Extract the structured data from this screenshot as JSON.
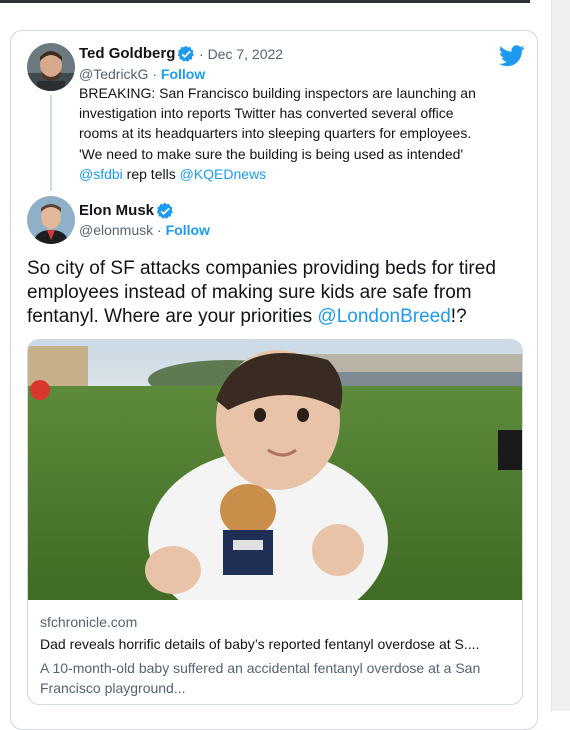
{
  "quoted_tweet": {
    "author_name": "Ted Goldberg",
    "handle": "@TedrickG",
    "date": "Dec 7, 2022",
    "separator": "·",
    "follow_label": "Follow",
    "text_lines": [
      "BREAKING: San Francisco building inspectors are launching an",
      "investigation into reports Twitter has  converted several office",
      "rooms at its headquarters into sleeping quarters for employees.",
      "'We need to make sure the building is being used as intended'"
    ],
    "mention_1": "@sfdbi",
    "mention_middle": " rep tells ",
    "mention_2": "@KQEDnews"
  },
  "main_tweet": {
    "author_name": "Elon Musk",
    "handle": "@elonmusk",
    "follow_label": "Follow",
    "text_before": "So city of SF attacks companies providing beds for tired employees instead of making sure kids are safe from fentanyl. Where are your priorities ",
    "mention": "@LondonBreed",
    "text_after": "!?"
  },
  "link_card": {
    "domain": "sfchronicle.com",
    "title": "Dad reveals horrific details of baby’s reported fentanyl overdose at S....",
    "description": "A 10-month-old baby suffered an accidental fentanyl overdose at a San Francisco playground..."
  },
  "colors": {
    "accent": "#1d9bf0",
    "text": "#0f1419",
    "muted": "#536471",
    "border": "#cfd9de"
  },
  "icons": [
    "twitter-bird-icon",
    "verified-badge-icon"
  ]
}
